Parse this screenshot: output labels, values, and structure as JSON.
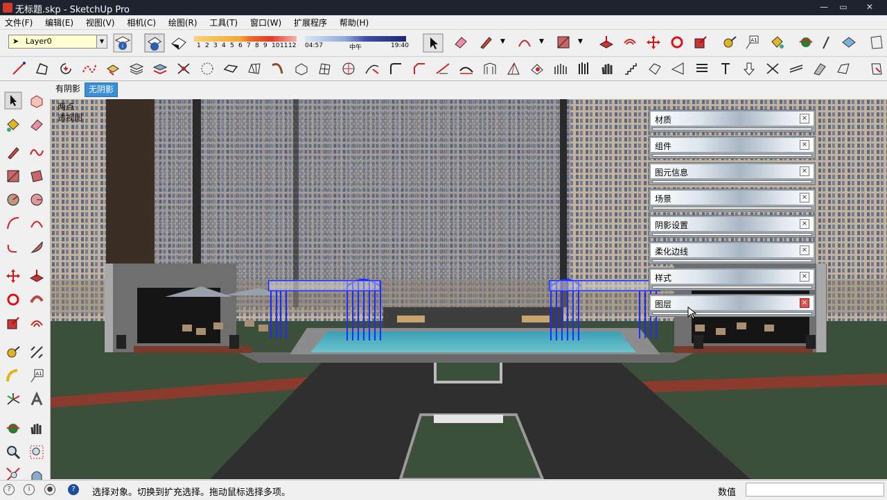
{
  "window": {
    "title": "无标题.skp - SketchUp Pro"
  },
  "menu": [
    "文件(F)",
    "编辑(E)",
    "视图(V)",
    "相机(C)",
    "绘图(R)",
    "工具(T)",
    "窗口(W)",
    "扩展程序",
    "帮助(H)"
  ],
  "layer": {
    "current": "Layer0"
  },
  "shadow": {
    "months": [
      "1",
      "2",
      "3",
      "4",
      "5",
      "6",
      "7",
      "8",
      "9",
      "10",
      "11",
      "12"
    ],
    "time_start": "04:57",
    "time_mid": "中午",
    "time_end": "19:40"
  },
  "scene_tabs": [
    {
      "label": "有阴影",
      "active": false
    },
    {
      "label": "无阴影",
      "active": true
    }
  ],
  "viewport": {
    "line1": "两点",
    "line2": "透视图"
  },
  "trays": [
    {
      "label": "材质"
    },
    {
      "label": "组件"
    },
    {
      "label": "图元信息"
    },
    {
      "label": "场景"
    },
    {
      "label": "阴影设置"
    },
    {
      "label": "柔化边线"
    },
    {
      "label": "样式"
    },
    {
      "label": "图层"
    }
  ],
  "status": {
    "message": "选择对象。切换到扩充选择。拖动鼠标选择多项。",
    "value_label": "数值",
    "value": ""
  },
  "colors": {
    "selection": "#1a2cff",
    "tab_active": "#3b8fd8",
    "title_bg": "#1d2430"
  }
}
